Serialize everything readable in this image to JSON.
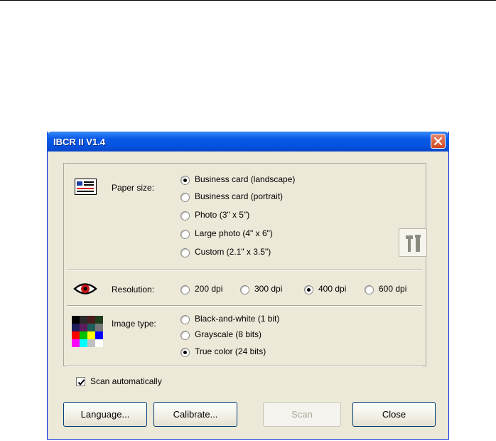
{
  "window": {
    "title": "IBCR II V1.4"
  },
  "paper_size": {
    "label": "Paper size:",
    "options": [
      {
        "label": "Business card (landscape)",
        "selected": true
      },
      {
        "label": "Business card (portrait)",
        "selected": false
      },
      {
        "label": "Photo (3\" x 5\")",
        "selected": false
      },
      {
        "label": "Large photo (4\" x 6\")",
        "selected": false
      },
      {
        "label": "Custom (2.1\" x 3.5\")",
        "selected": false
      }
    ]
  },
  "resolution": {
    "label": "Resolution:",
    "options": [
      {
        "label": "200 dpi",
        "selected": false
      },
      {
        "label": "300 dpi",
        "selected": false
      },
      {
        "label": "400 dpi",
        "selected": true
      },
      {
        "label": "600 dpi",
        "selected": false
      }
    ]
  },
  "image_type": {
    "label": "Image type:",
    "options": [
      {
        "label": "Black-and-white (1 bit)",
        "selected": false
      },
      {
        "label": "Grayscale (8 bits)",
        "selected": false
      },
      {
        "label": "True color (24 bits)",
        "selected": true
      }
    ]
  },
  "scan_auto": {
    "label": "Scan automatically",
    "checked": true
  },
  "buttons": {
    "language": "Language...",
    "calibrate": "Calibrate...",
    "scan": "Scan",
    "close": "Close"
  },
  "icons": {
    "paper": "business-card-icon",
    "resolution": "eye-icon",
    "image_type": "color-palette-icon",
    "tools": "tools-icon",
    "close": "close-icon"
  },
  "colors": {
    "titlebar": "#0554e0",
    "window_bg": "#ece9d8",
    "close_button": "#d44720"
  }
}
